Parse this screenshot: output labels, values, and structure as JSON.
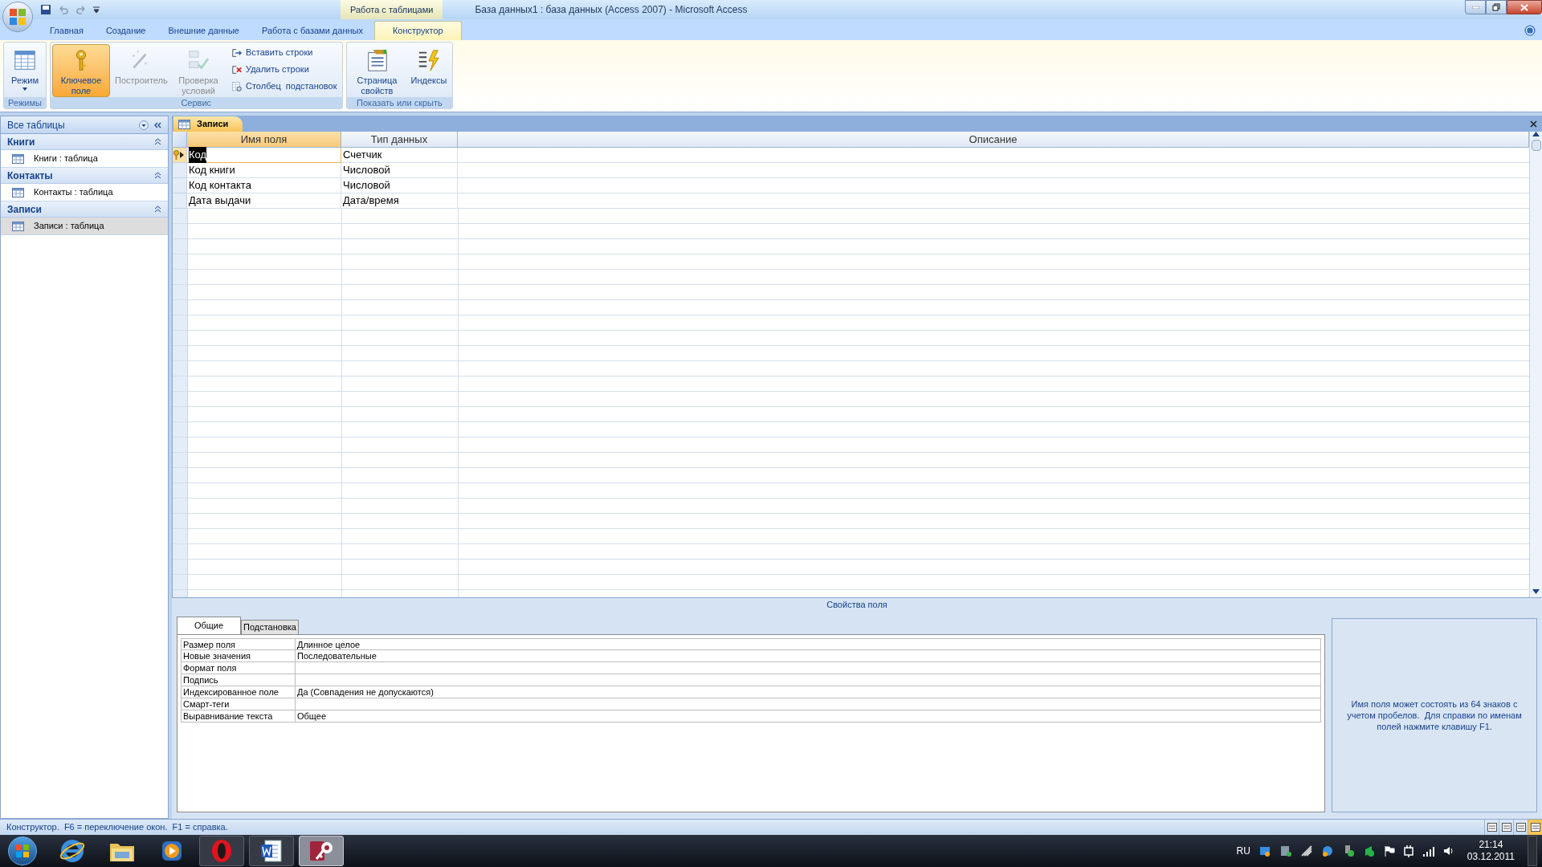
{
  "window": {
    "title": "База данных1 : база данных (Access 2007) - Microsoft Access",
    "context_group": "Работа с таблицами"
  },
  "ribbon_tabs": [
    {
      "label": "Главная",
      "selected": false
    },
    {
      "label": "Создание",
      "selected": false
    },
    {
      "label": "Внешние данные",
      "selected": false
    },
    {
      "label": "Работа с базами данных",
      "selected": false
    },
    {
      "label": "Конструктор",
      "selected": true
    }
  ],
  "ribbon_groups": [
    {
      "label": "Режимы",
      "items": [
        {
          "kind": "large",
          "label": "Режим",
          "dropdown": true,
          "pressed": false,
          "disabled": false
        }
      ]
    },
    {
      "label": "Сервис",
      "items": [
        {
          "kind": "large",
          "label": "Ключевое поле",
          "dropdown": false,
          "pressed": true,
          "disabled": false
        },
        {
          "kind": "large",
          "label": "Построитель",
          "dropdown": false,
          "pressed": false,
          "disabled": true
        },
        {
          "kind": "large",
          "label": "Проверка условий",
          "dropdown": false,
          "pressed": false,
          "disabled": true
        },
        {
          "kind": "small",
          "label": "Вставить строки",
          "disabled": false
        },
        {
          "kind": "small",
          "label": "Удалить строки",
          "disabled": false
        },
        {
          "kind": "small",
          "label": "Столбец  подстановок",
          "disabled": false
        }
      ]
    },
    {
      "label": "Показать или скрыть",
      "items": [
        {
          "kind": "large",
          "label": "Страница свойств",
          "dropdown": false,
          "pressed": false,
          "disabled": false
        },
        {
          "kind": "large",
          "label": "Индексы",
          "dropdown": false,
          "pressed": false,
          "disabled": false
        }
      ]
    }
  ],
  "nav_pane": {
    "title": "Все таблицы",
    "groups": [
      {
        "label": "Книги",
        "items": [
          {
            "label": "Книги : таблица",
            "selected": false
          }
        ]
      },
      {
        "label": "Контакты",
        "items": [
          {
            "label": "Контакты : таблица",
            "selected": false
          }
        ]
      },
      {
        "label": "Записи",
        "items": [
          {
            "label": "Записи : таблица",
            "selected": true
          }
        ]
      }
    ]
  },
  "document_tab": "Записи",
  "design_grid": {
    "columns": [
      "Имя поля",
      "Тип данных",
      "Описание"
    ],
    "rows": [
      {
        "field_name": "Код",
        "data_type": "Счетчик",
        "primary_key": true,
        "current": true
      },
      {
        "field_name": "Код книги",
        "data_type": "Числовой",
        "primary_key": false,
        "current": false
      },
      {
        "field_name": "Код контакта",
        "data_type": "Числовой",
        "primary_key": false,
        "current": false
      },
      {
        "field_name": "Дата выдачи",
        "data_type": "Дата/время",
        "primary_key": false,
        "current": false
      }
    ]
  },
  "field_properties": {
    "heading": "Свойства поля",
    "tabs": [
      {
        "label": "Общие",
        "selected": true
      },
      {
        "label": "Подстановка",
        "selected": false
      }
    ],
    "rows": [
      {
        "label": "Размер поля",
        "value": "Длинное целое"
      },
      {
        "label": "Новые значения",
        "value": "Последовательные"
      },
      {
        "label": "Формат поля"
      },
      {
        "label": "Подпись"
      },
      {
        "label": "Индексированное поле",
        "value": "Да (Совпадения не допускаются)"
      },
      {
        "label": "Смарт-теги"
      },
      {
        "label": "Выравнивание текста",
        "value": "Общее"
      }
    ],
    "help": "Имя поля может состоять из 64 знаков с учетом пробелов.  Для справки по именам полей нажмите клавишу F1."
  },
  "status_bar": {
    "text": "Конструктор.  F6 = переключение окон.  F1 = справка.",
    "views": [
      {
        "selected": false
      },
      {
        "selected": false
      },
      {
        "selected": false
      },
      {
        "selected": true
      }
    ]
  },
  "taskbar": {
    "apps": [
      {
        "kind": "browser-e",
        "active": false,
        "running": false
      },
      {
        "kind": "folder",
        "active": false,
        "running": false
      },
      {
        "kind": "player",
        "active": false,
        "running": false
      },
      {
        "kind": "opera",
        "active": false,
        "running": true
      },
      {
        "kind": "word",
        "active": false,
        "running": true
      },
      {
        "kind": "access",
        "active": true,
        "running": true
      }
    ],
    "language": "RU",
    "time": "21:14",
    "date": "03.12.2011"
  }
}
